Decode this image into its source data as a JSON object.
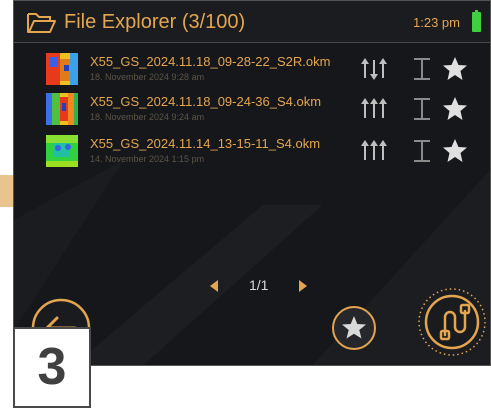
{
  "header": {
    "title": "File Explorer (3/100)",
    "time": "1:23 pm",
    "folder_icon": "folder-open-icon",
    "battery_icon": "battery-full-icon"
  },
  "files": [
    {
      "name": "X55_GS_2024.11.18_09-28-22_S2R.okm",
      "date": "18. November 2024 9:28 am"
    },
    {
      "name": "X55_GS_2024.11.18_09-24-36_S4.okm",
      "date": "18. November 2024 9:24 am"
    },
    {
      "name": "X55_GS_2024.11.14_13-15-11_S4.okm",
      "date": "14. November 2024 1:15 pm"
    }
  ],
  "pagination": {
    "label": "1/1"
  },
  "badge": {
    "number": "3"
  },
  "colors": {
    "accent": "#e4a54f",
    "background": "#15171a",
    "battery": "#3fcf3f"
  }
}
